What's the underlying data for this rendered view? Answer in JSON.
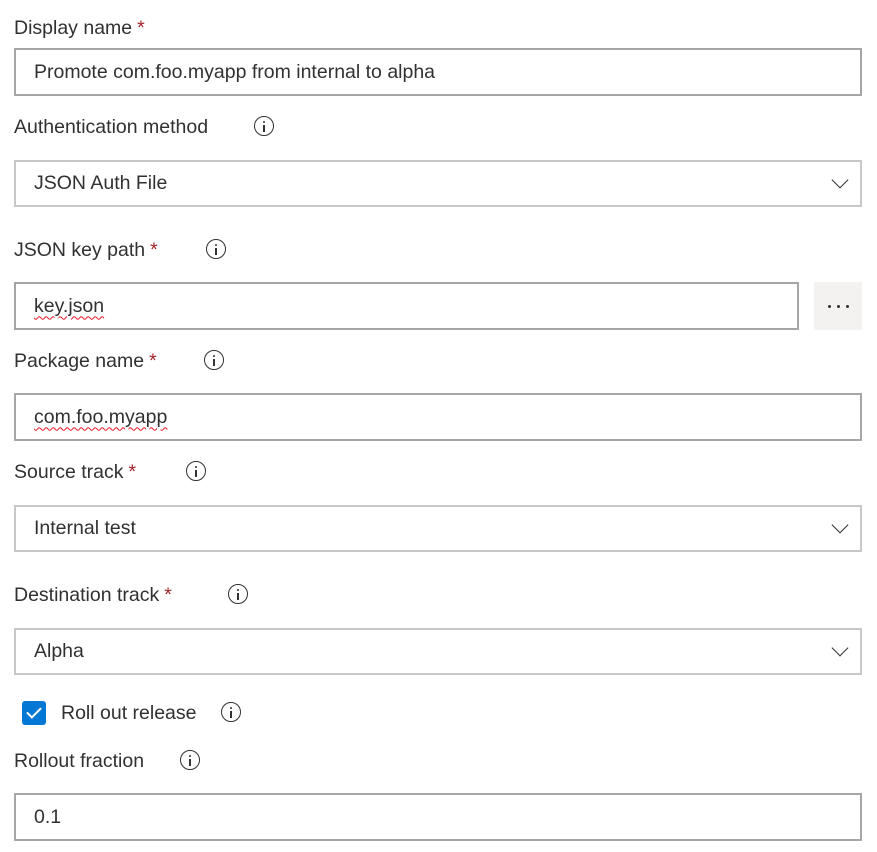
{
  "form": {
    "display_name": {
      "label": "Display name",
      "required_mark": "*",
      "value": "Promote com.foo.myapp from internal to alpha"
    },
    "auth_method": {
      "label": "Authentication method",
      "value": "JSON Auth File",
      "icon": "info-icon"
    },
    "json_key_path": {
      "label": "JSON key path",
      "required_mark": "*",
      "value": "key.json",
      "browse_label": "...",
      "icon": "info-icon"
    },
    "package_name": {
      "label": "Package name",
      "required_mark": "*",
      "value": "com.foo.myapp",
      "icon": "info-icon"
    },
    "source_track": {
      "label": "Source track",
      "required_mark": "*",
      "value": "Internal test",
      "icon": "info-icon"
    },
    "destination_track": {
      "label": "Destination track",
      "required_mark": "*",
      "value": "Alpha",
      "icon": "info-icon"
    },
    "roll_out_release": {
      "label": "Roll out release",
      "checked": true,
      "icon": "info-icon"
    },
    "rollout_fraction": {
      "label": "Rollout fraction",
      "value": "0.1",
      "icon": "info-icon"
    }
  },
  "colors": {
    "accent": "#0078d4",
    "required": "#a4262c",
    "text": "#323130",
    "input_border": "#a6a6a6",
    "dropdown_border": "#c8c8c8",
    "button_bg": "#f3f2f1"
  }
}
